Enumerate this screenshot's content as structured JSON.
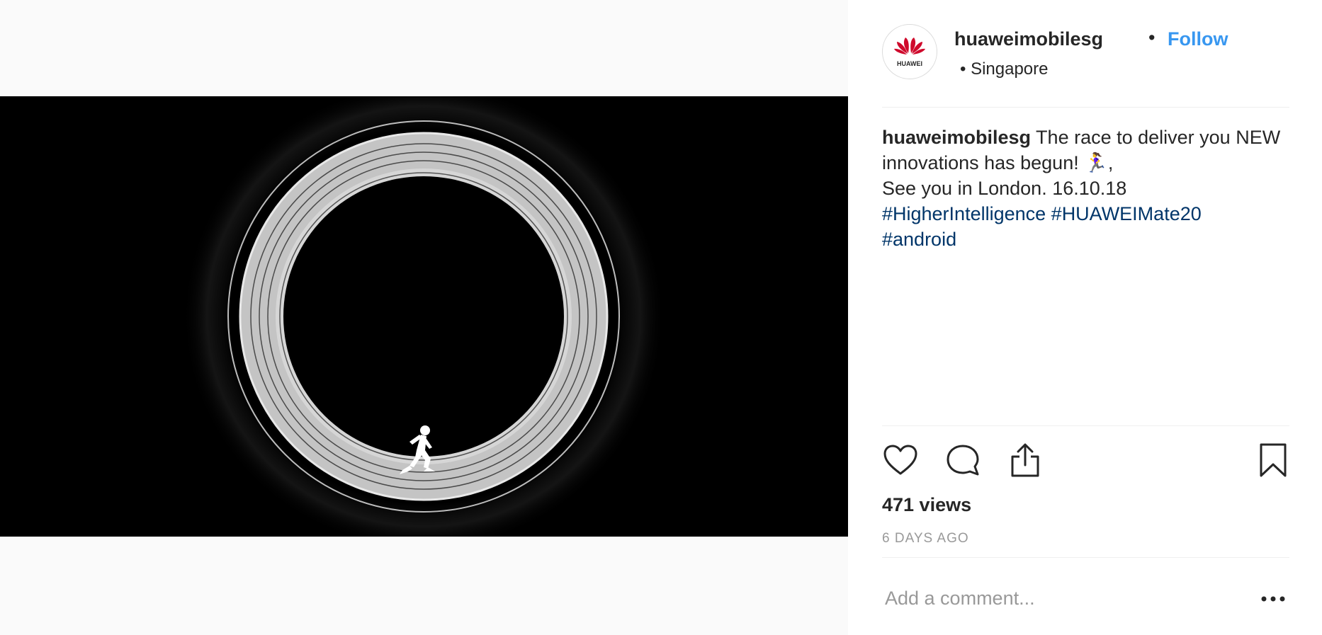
{
  "post": {
    "username": "huaweimobilesg",
    "separator": "•",
    "follow_label": "Follow",
    "location": "• Singapore",
    "avatar_brand_text": "HUAWEI",
    "caption": {
      "user": "huaweimobilesg",
      "line1": " The race to deliver you NEW innovations has begun! 🏃‍♀️,",
      "line2": "See you in London. 16.10.18",
      "hashtags": [
        "#HigherIntelligence",
        "#HUAWEIMate20",
        "#android"
      ]
    },
    "views": "471 views",
    "timestamp": "6 DAYS AGO"
  },
  "comment": {
    "placeholder": "Add a comment..."
  },
  "icons": {
    "like": "heart-icon",
    "comment": "comment-bubble-icon",
    "share": "share-icon",
    "save": "bookmark-icon",
    "more": "more-dots-icon"
  },
  "colors": {
    "brand_red": "#cf0a2c",
    "follow_blue": "#3897f0",
    "hashtag": "#003569",
    "muted": "#999999"
  }
}
